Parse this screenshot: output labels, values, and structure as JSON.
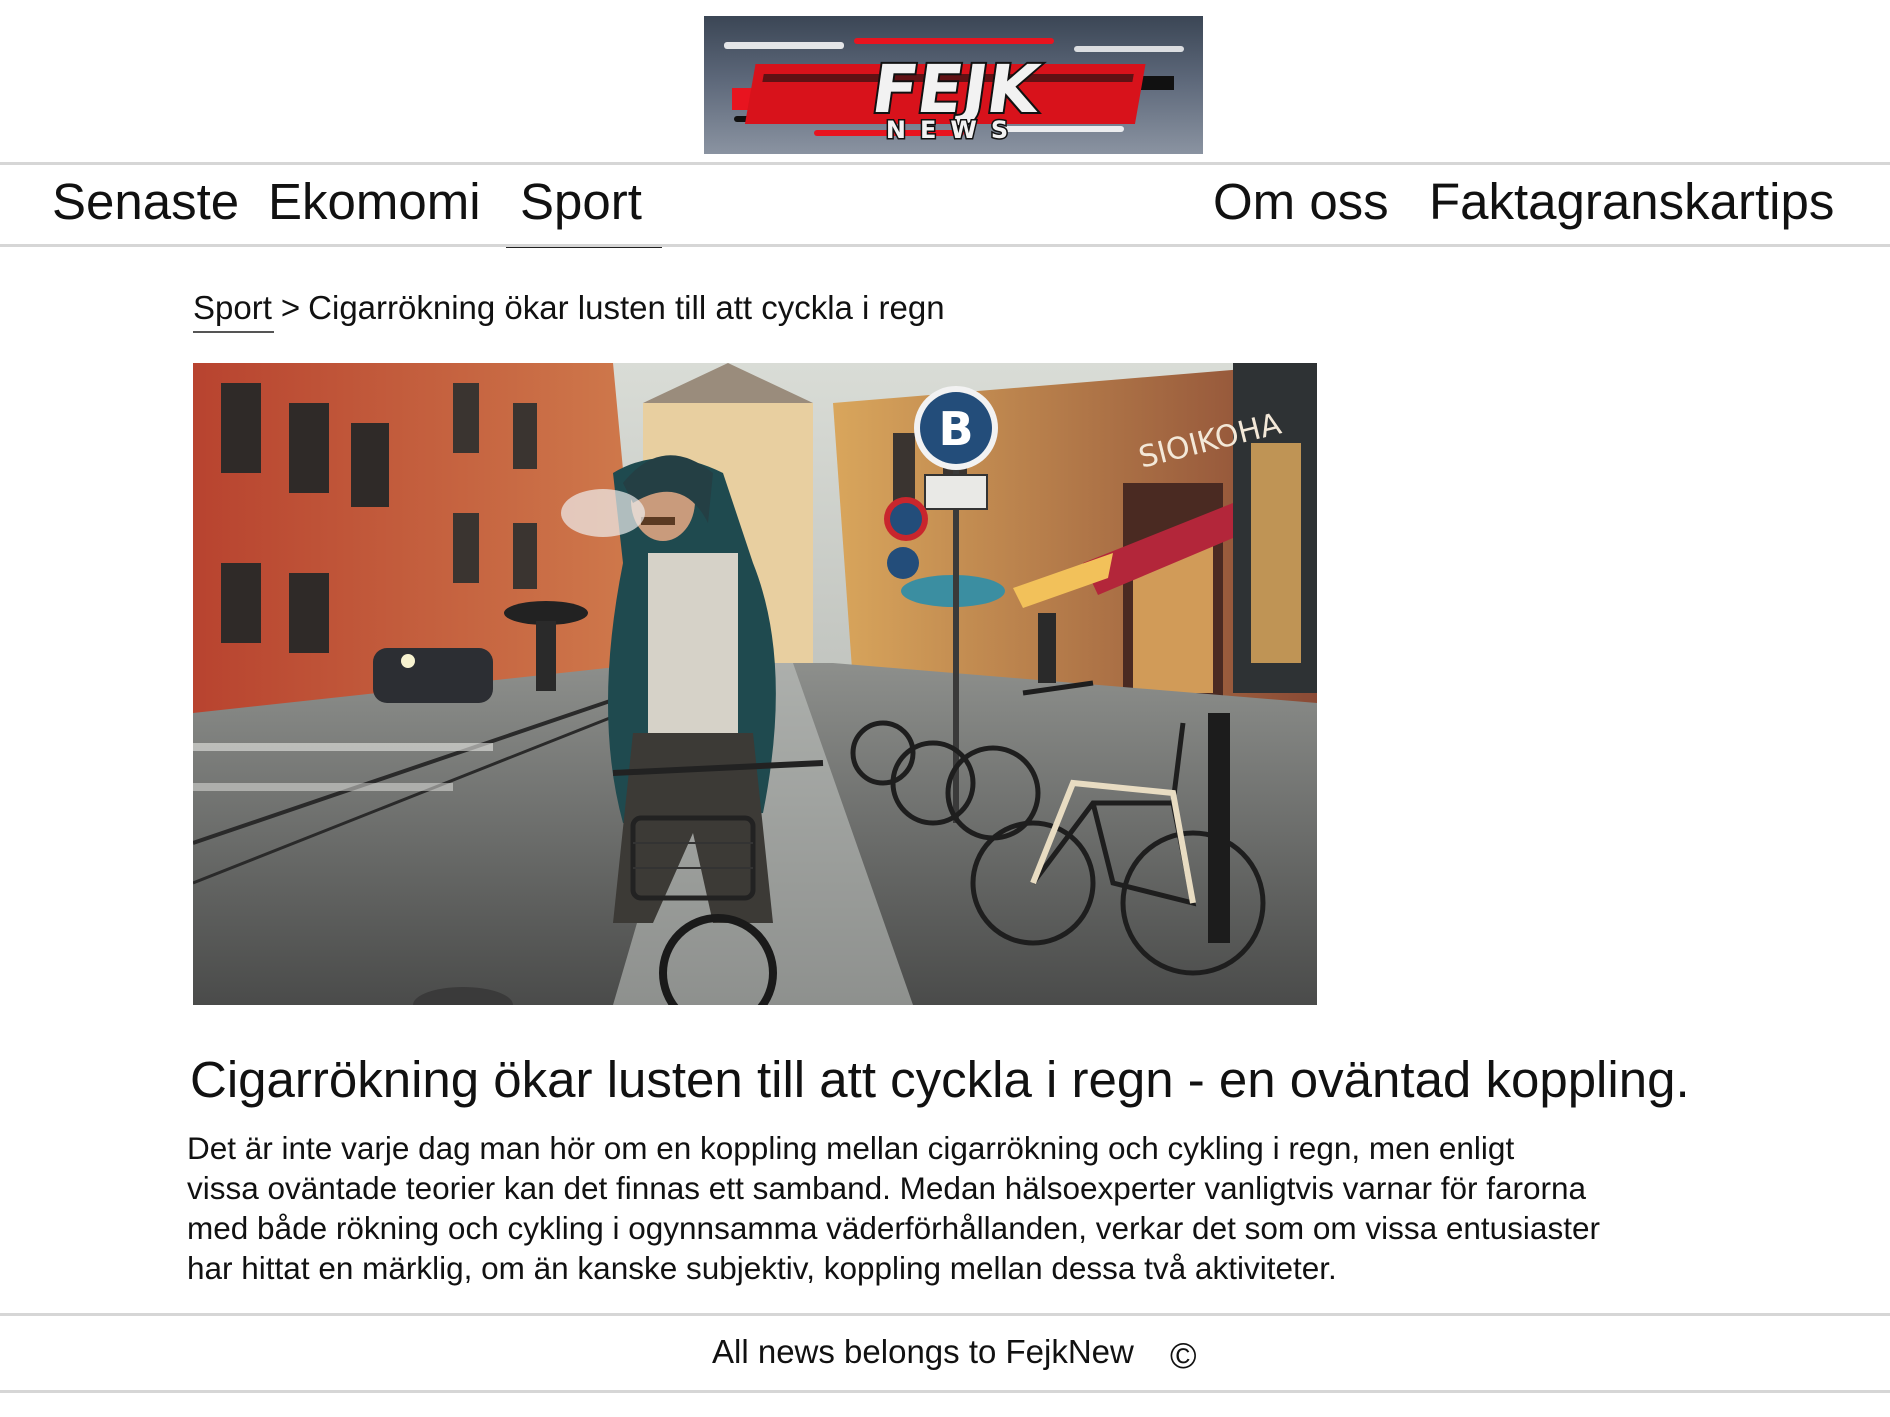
{
  "logo": {
    "wordmark": "FEJK",
    "subword": "NEWS"
  },
  "nav": {
    "items": [
      {
        "label": "Senaste"
      },
      {
        "label": "Ekomomi"
      },
      {
        "label": "Sport",
        "active": true
      },
      {
        "label": "Om oss"
      },
      {
        "label": "Faktagranskartips"
      }
    ]
  },
  "breadcrumb": {
    "section": "Sport",
    "separator": ">",
    "current": "Cigarrökning ökar lusten till att cyckla i regn"
  },
  "hero": {
    "shop_sign": "SIOIKOHA",
    "sign_letter": "B"
  },
  "article": {
    "headline": "Cigarrökning ökar lusten till att cyckla i regn - en oväntad koppling.",
    "body_lines": [
      "Det är inte varje dag man hör om en koppling mellan cigarrökning och cykling i regn, men enligt",
      "vissa oväntade teorier kan det finnas ett samband. Medan hälsoexperter vanligtvis varnar för farorna",
      "med både rökning och cykling i ogynnsamma väderförhållanden, verkar det som om vissa entusiaster",
      "har hittat en märklig, om än kanske subjektiv, koppling mellan dessa två aktiviteter."
    ]
  },
  "footer": {
    "text": "All news belongs to FejkNew",
    "copyright_symbol": "©"
  },
  "colors": {
    "logo_red": "#e8141f",
    "logo_dark": "#3b4655",
    "rule": "#d6d6d6",
    "text": "#111111"
  }
}
